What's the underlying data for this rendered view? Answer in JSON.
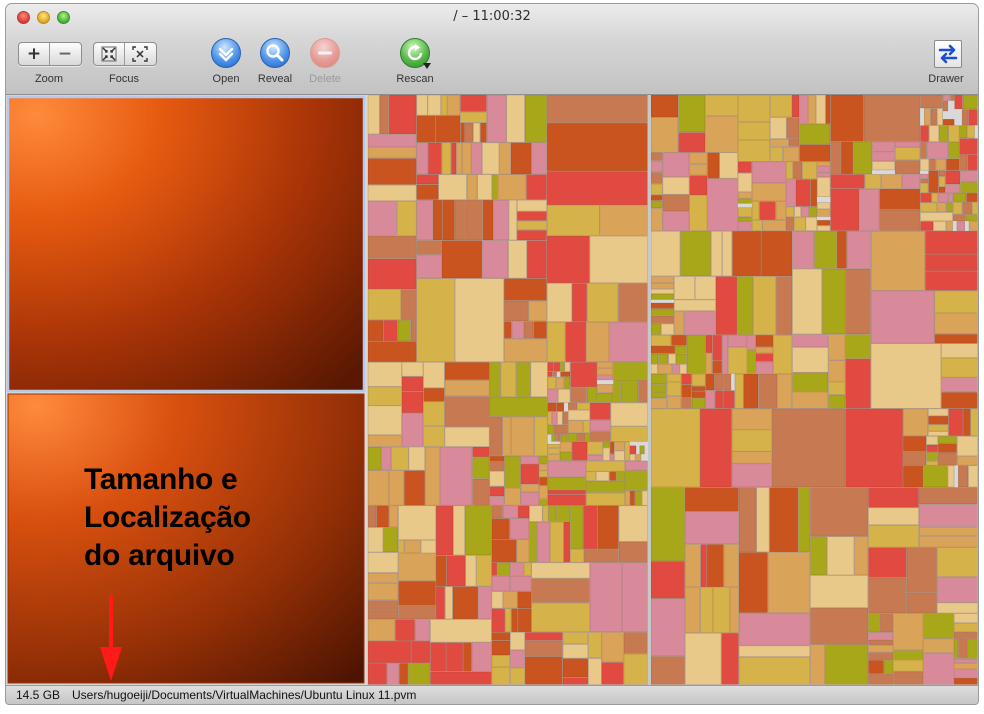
{
  "window": {
    "title": "/ – 11:00:32"
  },
  "toolbar": {
    "zoom": {
      "label": "Zoom",
      "plus": "+",
      "minus": "−"
    },
    "focus": {
      "label": "Focus"
    },
    "open": {
      "label": "Open"
    },
    "reveal": {
      "label": "Reveal"
    },
    "delete": {
      "label": "Delete",
      "enabled": false
    },
    "rescan": {
      "label": "Rescan"
    },
    "drawer": {
      "label": "Drawer"
    }
  },
  "icons": {
    "zoom-in": "zoom-in-icon",
    "zoom-out": "zoom-out-icon",
    "focus-in": "focus-in-icon",
    "focus-out": "focus-out-icon",
    "open": "open-icon",
    "reveal": "magnifier-icon",
    "delete": "delete-icon",
    "rescan": "refresh-icon",
    "drawer": "drawer-arrows-icon"
  },
  "status": {
    "size": "14.5 GB",
    "path": "Users/hugoeiji/Documents/VirtualMachines/Ubuntu Linux 11.pvm"
  },
  "annotation": {
    "lines": [
      "Tamanho e",
      "Localização",
      "do arquivo"
    ],
    "arrow_color": "#ff1a1a"
  },
  "colors": {
    "selected_file": "#d9500f",
    "selection_outline": "#b7c9e8",
    "palette": [
      "#e8c989",
      "#d9a35a",
      "#c9541f",
      "#e04a40",
      "#d98a9a",
      "#a8a619",
      "#d6b34a",
      "#c77a52"
    ]
  }
}
